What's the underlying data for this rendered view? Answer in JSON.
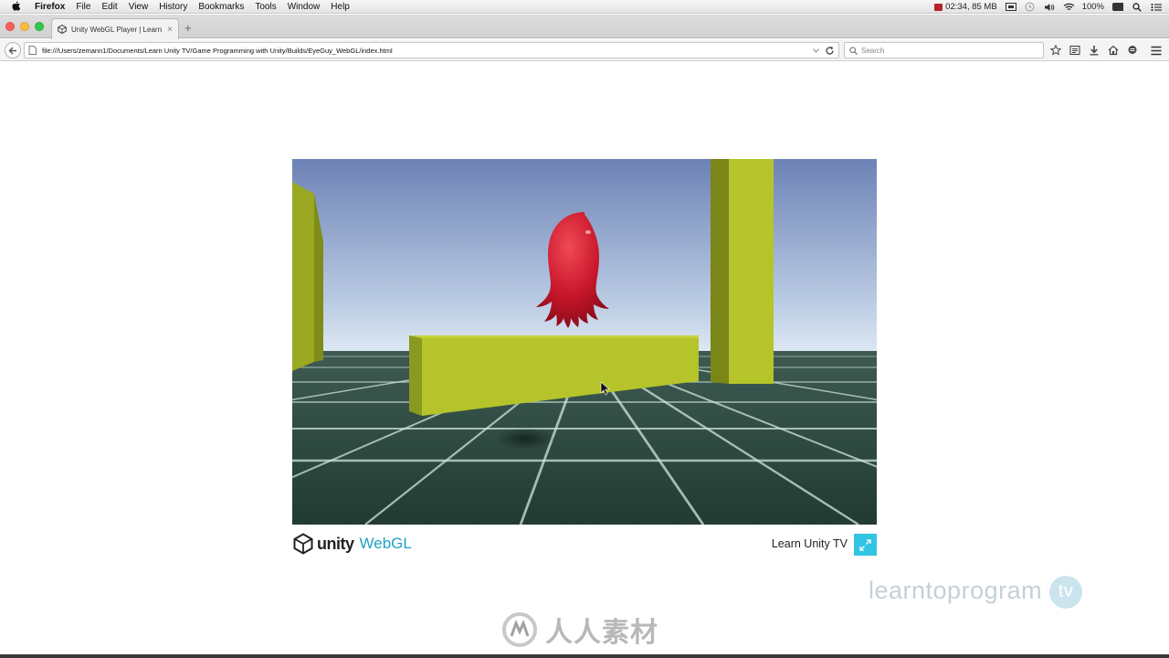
{
  "menubar": {
    "app_name": "Firefox",
    "items": [
      "File",
      "Edit",
      "View",
      "History",
      "Bookmarks",
      "Tools",
      "Window",
      "Help"
    ],
    "status": "02:34, 85 MB",
    "battery": "100%"
  },
  "tab": {
    "title": "Unity WebGL Player | Learn ...",
    "close_symbol": "×",
    "new_tab_symbol": "+"
  },
  "navbar": {
    "url": "file:///Users/zemann1/Documents/Learn Unity TV/Game Programming with Unity/Builds/EyeGuy_WebGL/index.html",
    "search_placeholder": "Search"
  },
  "page": {
    "unity_wordmark": "unity",
    "webgl_label": "WebGL",
    "title": "Learn Unity TV",
    "brand_text": "learntoprogram",
    "brand_tv": "tv",
    "site_watermark": "人人素材"
  },
  "colors": {
    "accent": "#34c4e3",
    "webgl_text": "#1fa3c7",
    "sky_top": "#6f86b8",
    "sky_horizon": "#d7e3f2",
    "wall": "#b4c42a",
    "creature": "#cc1a2a",
    "floor": "#2d4a3f"
  },
  "icons": [
    "apple-icon",
    "wifi-icon",
    "volume-icon",
    "search-icon",
    "notification-icon",
    "back-icon",
    "reload-icon",
    "bookmark-star-icon",
    "reading-list-icon",
    "download-icon",
    "home-icon",
    "chat-icon",
    "hamburger-icon",
    "fullscreen-icon"
  ]
}
